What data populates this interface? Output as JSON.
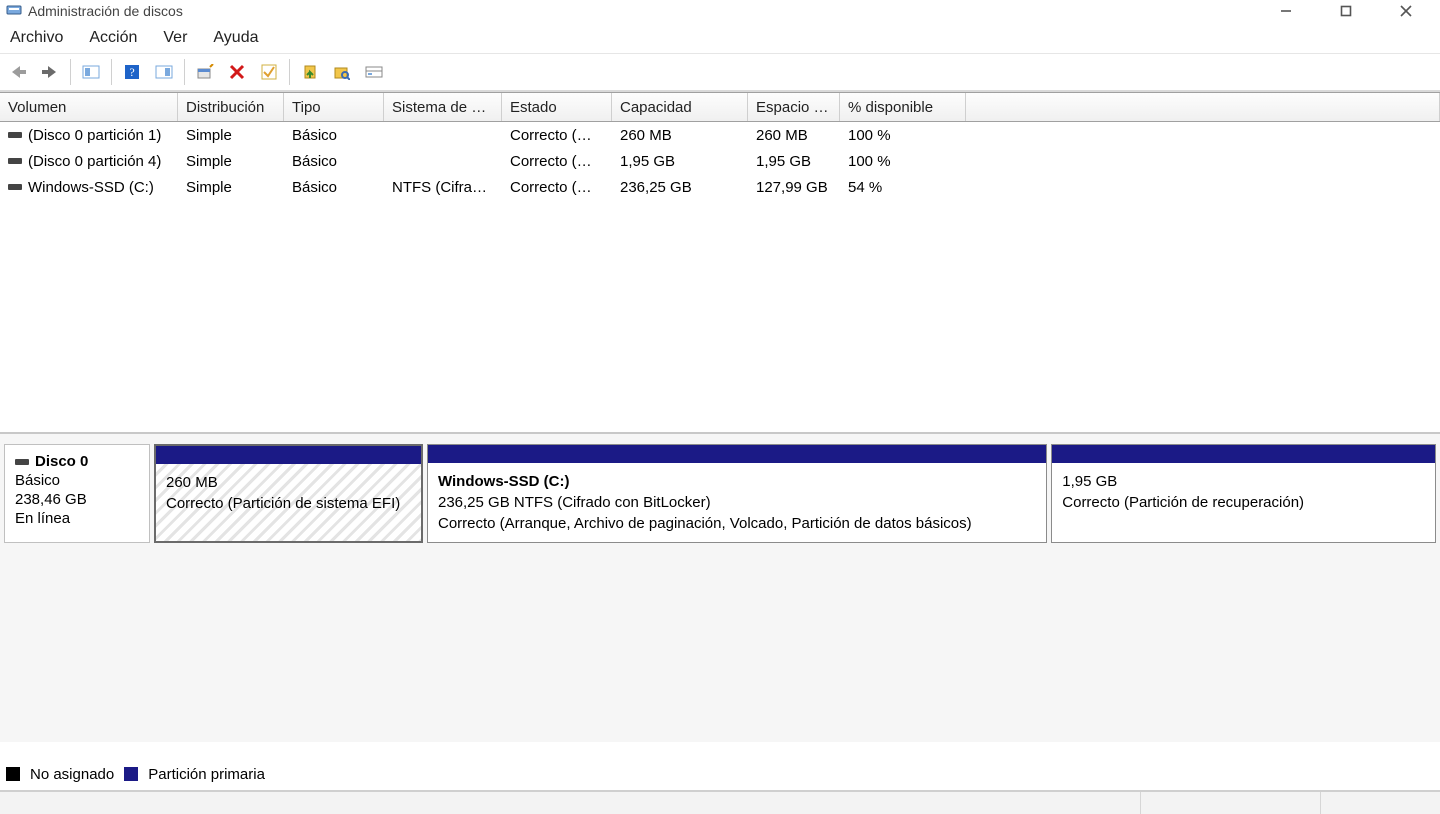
{
  "window": {
    "title": "Administración de discos"
  },
  "menu": {
    "archivo": "Archivo",
    "accion": "Acción",
    "ver": "Ver",
    "ayuda": "Ayuda"
  },
  "columns": {
    "volumen": "Volumen",
    "distribucion": "Distribución",
    "tipo": "Tipo",
    "sistema": "Sistema de …",
    "estado": "Estado",
    "capacidad": "Capacidad",
    "espacio": "Espacio …",
    "pct": "% disponible"
  },
  "rows": [
    {
      "volumen": "(Disco 0 partición 1)",
      "distribucion": "Simple",
      "tipo": "Básico",
      "sistema": "",
      "estado": "Correcto (…",
      "capacidad": "260 MB",
      "espacio": "260 MB",
      "pct": "100 %"
    },
    {
      "volumen": "(Disco 0 partición 4)",
      "distribucion": "Simple",
      "tipo": "Básico",
      "sistema": "",
      "estado": "Correcto (…",
      "capacidad": "1,95 GB",
      "espacio": "1,95 GB",
      "pct": "100 %"
    },
    {
      "volumen": "Windows-SSD (C:)",
      "distribucion": "Simple",
      "tipo": "Básico",
      "sistema": "NTFS (Cifra…",
      "estado": "Correcto (…",
      "capacidad": "236,25 GB",
      "espacio": "127,99 GB",
      "pct": "54 %"
    }
  ],
  "disk": {
    "name": "Disco 0",
    "type": "Básico",
    "size": "238,46 GB",
    "status": "En línea",
    "parts": [
      {
        "name": "",
        "size": "260 MB",
        "desc": "Correcto (Partición de sistema EFI)",
        "kind": "efi",
        "flex": 18
      },
      {
        "name": "Windows-SSD  (C:)",
        "size": "236,25 GB NTFS (Cifrado con BitLocker)",
        "desc": "Correcto (Arranque, Archivo de paginación, Volcado, Partición de datos básicos)",
        "kind": "primary",
        "flex": 42
      },
      {
        "name": "",
        "size": "1,95 GB",
        "desc": "Correcto (Partición de recuperación)",
        "kind": "primary",
        "flex": 26
      }
    ]
  },
  "legend": {
    "unallocated": "No asignado",
    "primary": "Partición primaria"
  }
}
